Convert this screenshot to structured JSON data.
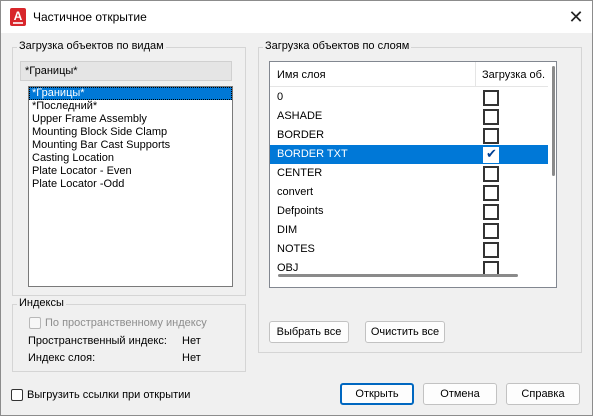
{
  "window": {
    "title": "Частичное открытие",
    "close_glyph": "✕",
    "app_icon_letter": "A"
  },
  "views": {
    "group_label": "Загрузка объектов по видам",
    "current_view": "*Границы*",
    "items": [
      "*Границы*",
      "*Последний*",
      "Upper Frame Assembly",
      "Mounting Block Side Clamp",
      "Mounting Bar Cast Supports",
      "Casting Location",
      "Plate Locator - Even",
      "Plate Locator -Odd"
    ],
    "selected_index": 0
  },
  "layers": {
    "group_label": "Загрузка объектов по слоям",
    "col_name": "Имя слоя",
    "col_load": "Загрузка об.",
    "rows": [
      {
        "name": "0",
        "checked": false
      },
      {
        "name": "ASHADE",
        "checked": false
      },
      {
        "name": "BORDER",
        "checked": false
      },
      {
        "name": "BORDER TXT",
        "checked": true
      },
      {
        "name": "CENTER",
        "checked": false
      },
      {
        "name": "convert",
        "checked": false
      },
      {
        "name": "Defpoints",
        "checked": false
      },
      {
        "name": "DIM",
        "checked": false
      },
      {
        "name": "NOTES",
        "checked": false
      },
      {
        "name": "OBJ",
        "checked": false
      }
    ],
    "selected_index": 3,
    "select_all_label": "Выбрать все",
    "clear_all_label": "Очистить все"
  },
  "indexes": {
    "group_label": "Индексы",
    "spatial_checkbox_label": "По пространственному индексу",
    "spatial_checked": false,
    "spatial_index_label": "Пространственный индекс:",
    "spatial_index_value": "Нет",
    "layer_index_label": "Индекс слоя:",
    "layer_index_value": "Нет"
  },
  "footer": {
    "unload_xrefs_label": "Выгрузить ссылки при открытии",
    "unload_xrefs_checked": false,
    "open_label": "Открыть",
    "cancel_label": "Отмена",
    "help_label": "Справка"
  },
  "colors": {
    "accent": "#0078d7",
    "autocad_red": "#d8262b"
  }
}
